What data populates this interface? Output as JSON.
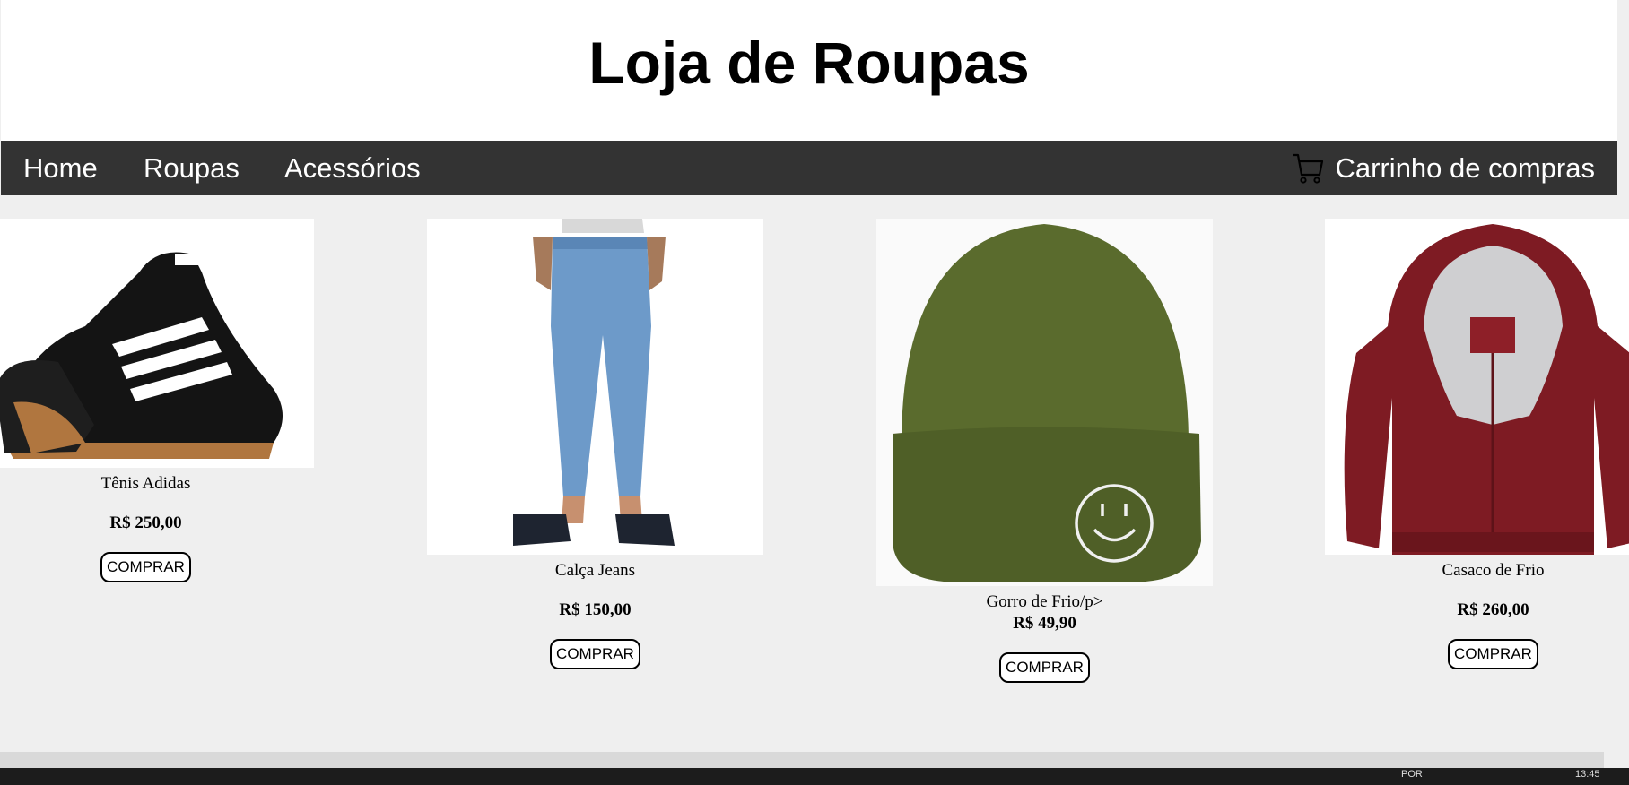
{
  "header": {
    "title": "Loja de Roupas"
  },
  "nav": {
    "items": [
      {
        "label": "Home"
      },
      {
        "label": "Roupas"
      },
      {
        "label": "Acessórios"
      }
    ],
    "cart": {
      "label": "Carrinho de compras",
      "icon": "cart-icon"
    }
  },
  "products": [
    {
      "name": "Tênis Adidas",
      "price": "R$ 250,00",
      "button": "COMPRAR"
    },
    {
      "name": "Calça Jeans",
      "price": "R$ 150,00",
      "button": "COMPRAR"
    },
    {
      "name": "Gorro de Frio/p>",
      "price": "R$ 49,90",
      "button": "COMPRAR"
    },
    {
      "name": "Casaco de Frio",
      "price": "R$ 260,00",
      "button": "COMPRAR"
    }
  ],
  "taskbar": {
    "lang": "POR",
    "time": "13:45"
  },
  "colors": {
    "navbar": "#333333",
    "page_background": "#efefef",
    "header_background": "#ffffff"
  }
}
